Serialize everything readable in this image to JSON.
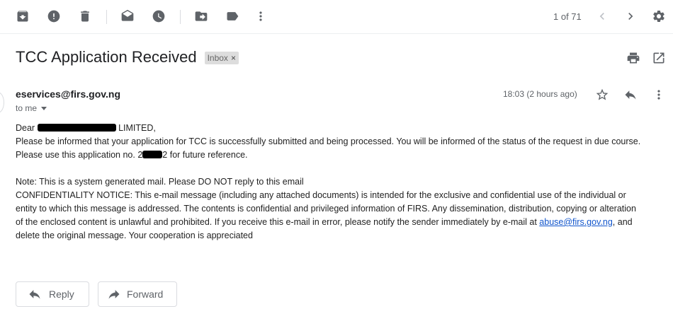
{
  "toolbar": {
    "icons": [
      "archive-icon",
      "report-spam-icon",
      "delete-icon",
      "mark-unread-icon",
      "snooze-icon",
      "move-to-icon",
      "labels-icon",
      "more-vert-icon"
    ],
    "counter": "1 of 71"
  },
  "email": {
    "subject": "TCC Application Received",
    "label": "Inbox",
    "label_remove": "×",
    "sender": "eservices@firs.gov.ng",
    "to": "to me",
    "time": "18:03 (2 hours ago)",
    "body": {
      "greeting_prefix": "Dear",
      "greeting_suffix": "LIMITED,",
      "line1": "Please be informed that your application for TCC is successfully submitted and being processed. You will be informed of the status of the request in due course.",
      "line2_prefix": "Please use this application no. 2",
      "line2_suffix": "2 for future reference.",
      "note": "Note: This is a system generated mail. Please DO NOT reply to this email",
      "notice_1": "CONFIDENTIALITY NOTICE: This e-mail message (including any attached  documents) is intended for the exclusive and confidential use of the individual or",
      "notice_2": "entity to which this message is addressed. The contents is confidential and privileged information of FIRS. Any dissemination, distribution, copying or alteration",
      "notice_3": "of the enclosed content is unlawful and prohibited. If you receive this e-mail in error, please notify the sender immediately by e-mail at",
      "notice_link": "abuse@firs.gov.ng",
      "notice_3_end": ", and",
      "notice_4": "delete the original message. Your cooperation is appreciated"
    }
  },
  "actions": {
    "reply": "Reply",
    "forward": "Forward"
  }
}
